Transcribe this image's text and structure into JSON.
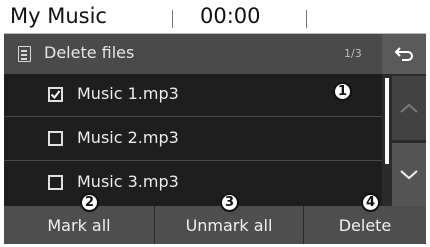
{
  "status": {
    "app_title": "My Music",
    "time": "00:00"
  },
  "header": {
    "title": "Delete files",
    "page": "1/3"
  },
  "files": [
    {
      "name": "Music 1.mp3",
      "checked": true
    },
    {
      "name": "Music 2.mp3",
      "checked": false
    },
    {
      "name": "Music 3.mp3",
      "checked": false
    }
  ],
  "buttons": {
    "mark_all": "Mark all",
    "unmark_all": "Unmark all",
    "delete": "Delete"
  },
  "callouts": [
    "1",
    "2",
    "3",
    "4"
  ]
}
